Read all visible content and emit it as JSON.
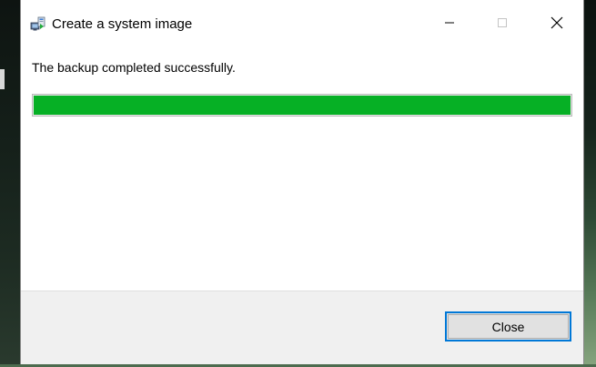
{
  "window": {
    "title": "Create a system image",
    "icon": "system-image-backup-icon"
  },
  "controls": {
    "minimize": "minimize-icon",
    "maximize": "maximize-icon",
    "close": "close-icon"
  },
  "main": {
    "status": "The backup completed successfully.",
    "progress": 1.0,
    "progress_color": "#06b025"
  },
  "footer": {
    "close_label": "Close",
    "accent_color": "#0078d7"
  }
}
